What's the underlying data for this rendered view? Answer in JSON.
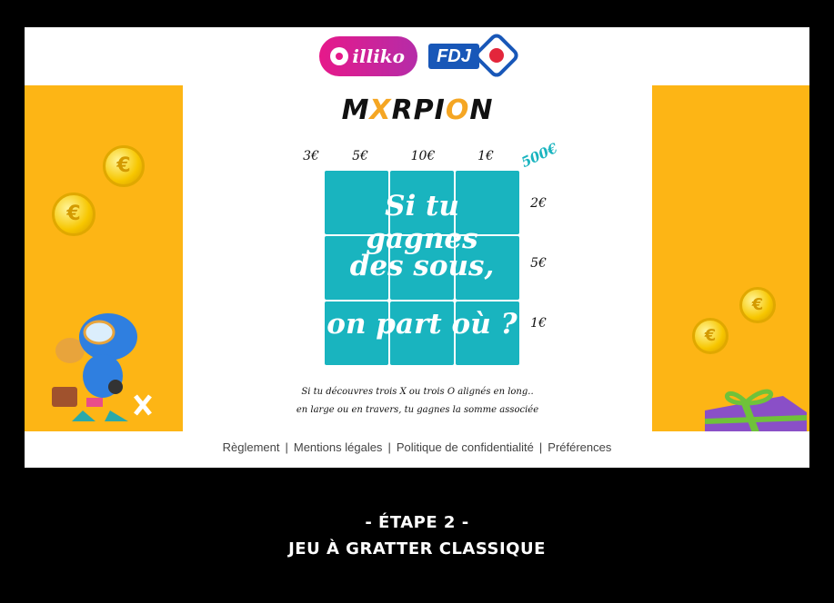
{
  "brand": {
    "illiko": "illiko",
    "fdj": "FDJ"
  },
  "game": {
    "title_prefix": "M",
    "title_o1": "X",
    "title_mid": "RPI",
    "title_o2": "O",
    "title_suffix": "N",
    "column_prizes": [
      "3€",
      "5€",
      "10€",
      "1€"
    ],
    "jackpot": "500€",
    "row_prizes": [
      "2€",
      "5€",
      "1€"
    ],
    "overlay_lines": [
      "Si tu gagnes",
      "des sous,",
      "on part où ?"
    ],
    "rules_line1": "Si tu découvres trois X ou trois O alignés en long..",
    "rules_line2": "en large ou en travers, tu gagnes la somme associée"
  },
  "footer": {
    "links": [
      "Règlement",
      "Mentions légales",
      "Politique de confidentialité",
      "Préférences"
    ],
    "separator": "|"
  },
  "caption": {
    "step": "- ÉTAPE 2 -",
    "subtitle": "JEU À GRATTER CLASSIQUE"
  },
  "colors": {
    "accent": "#fdb515",
    "grid": "#19b4bf",
    "background": "#000000"
  }
}
